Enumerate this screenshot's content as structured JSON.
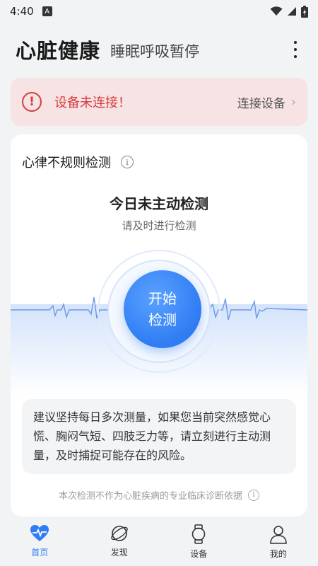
{
  "status_bar": {
    "time": "4:40",
    "badge": "A"
  },
  "header": {
    "title": "心脏健康",
    "subtitle": "睡眠呼吸暂停"
  },
  "alert": {
    "message": "设备未连接！",
    "action": "连接设备",
    "color": "#d63d3d"
  },
  "card": {
    "title": "心律不规则检测",
    "status": "今日未主动检测",
    "hint": "请及时进行检测",
    "start_button": {
      "line1": "开始",
      "line2": "检测"
    },
    "advice": "建议坚持每日多次测量，如果您当前突然感觉心慌、胸闷气短、四肢乏力等，请立刻进行主动测量，及时捕捉可能存在的风险。",
    "disclaimer": "本次检测不作为心脏疾病的专业临床诊断依据"
  },
  "bottom_nav": {
    "items": [
      {
        "label": "首页",
        "icon": "heart-pulse-icon",
        "active": true
      },
      {
        "label": "发现",
        "icon": "planet-icon",
        "active": false
      },
      {
        "label": "设备",
        "icon": "watch-icon",
        "active": false
      },
      {
        "label": "我的",
        "icon": "person-icon",
        "active": false
      }
    ]
  },
  "colors": {
    "accent": "#2f7cf3",
    "alert_bg": "#f7e2e4"
  }
}
